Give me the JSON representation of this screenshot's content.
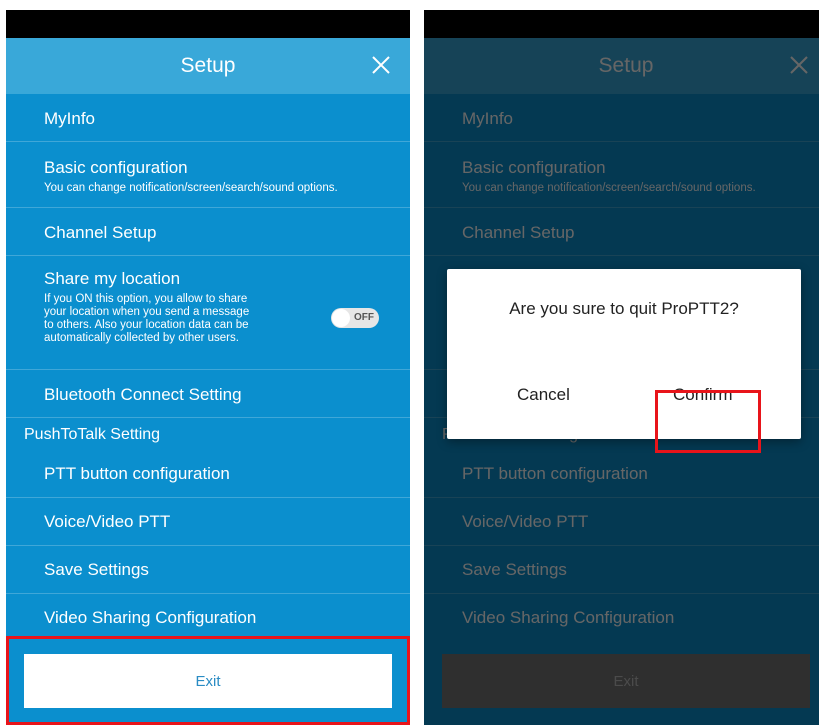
{
  "header": {
    "title": "Setup"
  },
  "menu": {
    "myinfo": "MyInfo",
    "basic": {
      "title": "Basic configuration",
      "desc": "You can change notification/screen/search/sound options."
    },
    "channel": "Channel Setup",
    "location": {
      "title": "Share my location",
      "desc": [
        "If you ON this option, you allow to share",
        "your location when you send a message",
        "to others. Also your location data can be",
        "automatically collected by other users."
      ],
      "toggle_label": "OFF",
      "toggle_on": false
    },
    "bluetooth": "Bluetooth Connect Setting",
    "section_ptt": "PushToTalk Setting",
    "ptt_button": "PTT button configuration",
    "voice_video": "Voice/Video PTT",
    "save": "Save Settings",
    "video_sharing": "Video Sharing Configuration"
  },
  "exit_label": "Exit",
  "dialog": {
    "message": "Are you sure to quit ProPTT2?",
    "cancel": "Cancel",
    "confirm": "Confirm"
  },
  "colors": {
    "primary": "#0b8fce",
    "header": "#39a8d9",
    "highlight": "#e8141a"
  }
}
